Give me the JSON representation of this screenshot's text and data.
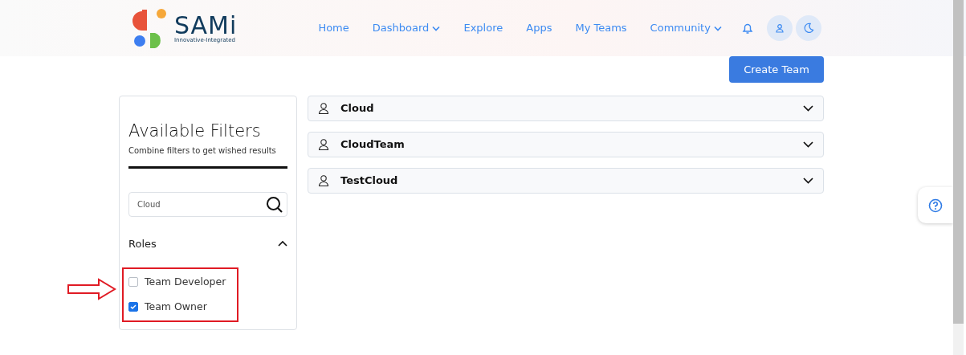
{
  "brand": {
    "name": "SAMi",
    "tagline": "Innovative-Integrated"
  },
  "nav": [
    {
      "label": "Home",
      "dropdown": false
    },
    {
      "label": "Dashboard",
      "dropdown": true
    },
    {
      "label": "Explore",
      "dropdown": false
    },
    {
      "label": "Apps",
      "dropdown": false
    },
    {
      "label": "My Teams",
      "dropdown": false
    },
    {
      "label": "Community",
      "dropdown": true
    }
  ],
  "create_button": "Create Team",
  "filters": {
    "title": "Available Filters",
    "subtitle": "Combine filters to get wished results",
    "search": {
      "value": "Cloud"
    },
    "roles": {
      "title": "Roles",
      "expanded": true,
      "items": [
        {
          "label": "Team Developer",
          "checked": false
        },
        {
          "label": "Team Owner",
          "checked": true
        }
      ]
    }
  },
  "teams": [
    {
      "name": "Cloud",
      "expanded": false
    },
    {
      "name": "CloudTeam",
      "expanded": false
    },
    {
      "name": "TestCloud",
      "expanded": false
    }
  ]
}
